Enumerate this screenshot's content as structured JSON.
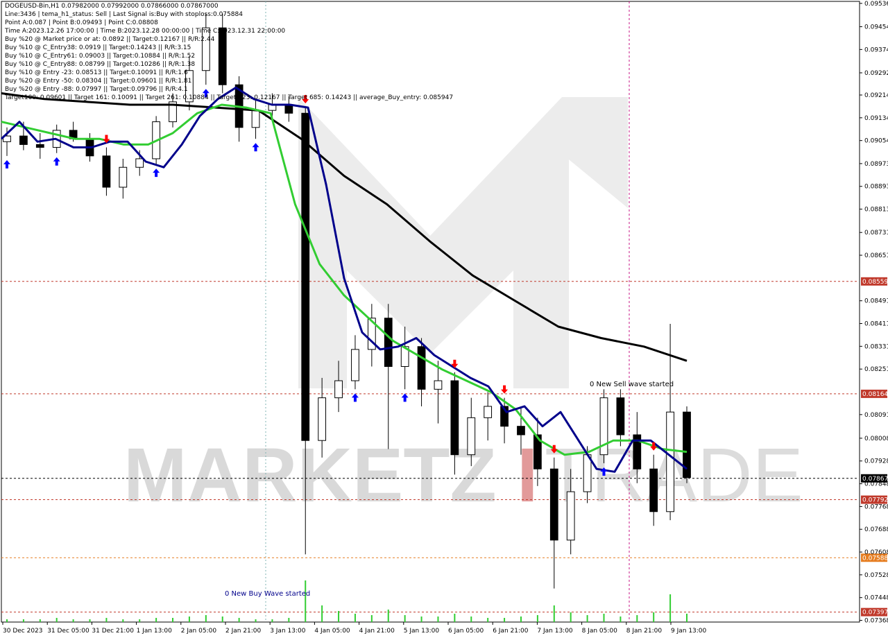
{
  "header": {
    "lines": [
      "DOGEUSD-Bin,H1  0.07982000 0.07992000 0.07866000 0.07867000",
      "Line:3436 | tema_h1_status: Sell | Last Signal is:Buy with stoploss:0.075884",
      "Point A:0.087 | Point B:0.09493 | Point C:0.08808",
      "Time A:2023.12.26 17:00:00 | Time B:2023.12.28 00:00:00 | Time C:2023.12.31 22:00:00",
      "Buy %20 @ Market price or at: 0.0892 || Target:0.12167 || R/R:2.44",
      "Buy %10 @ C_Entry38: 0.0919 || Target:0.14243 || R/R:3.15",
      "Buy %10 @ C_Entry61: 0.09003 || Target:0.10884 || R/R:1.52",
      "Buy %10 @ C_Entry88: 0.08799 || Target:0.10286 || R/R:1.38",
      "Buy %10 @ Entry -23: 0.08513 || Target:0.10091 || R/R:1.6",
      "Buy %20 @ Entry -50: 0.08304 || Target:0.09601 || R/R:1.81",
      "Buy %20 @ Entry -88: 0.07997 || Target:0.09796 || R/R:4.1",
      "Target100: 0.09601 || Target 161: 0.10091 || Target 261: 0.10884 || Target 423: 0.12167 || Target 685: 0.14243 || average_Buy_entry: 0.085947"
    ]
  },
  "watermark": {
    "left": "MARKETZ",
    "mid": "I",
    "right": "TRADE"
  },
  "annotations": {
    "sell_wave": "0 New Sell wave started",
    "buy_wave": "0 New Buy Wave started"
  },
  "colors": {
    "bull": "#000000",
    "bear": "#000000",
    "ema_fast": "#00008b",
    "ema_mid": "#32cd32",
    "ema_slow": "#000000",
    "buy_arrow": "#0000ff",
    "sell_arrow": "#ff0000",
    "level_line": "#b22222",
    "sell_tag": "#c0392b",
    "price_tag": "#000000",
    "volume": "#32cd32"
  },
  "chart_data": {
    "type": "candlestick",
    "symbol": "DOGEUSD-Bin",
    "timeframe": "H1",
    "y_ticks": [
      "0.09536",
      "0.09454",
      "0.09374",
      "0.09292",
      "0.09214",
      "0.09134",
      "0.09054",
      "0.08973",
      "0.08893",
      "0.08813",
      "0.08731",
      "0.08651",
      "0.08491",
      "0.08411",
      "0.08331",
      "0.08251",
      "0.08091",
      "0.08008",
      "0.07928",
      "0.07848",
      "0.07768",
      "0.07688",
      "0.07608",
      "0.07528",
      "0.07448",
      "0.07368"
    ],
    "ylim": [
      0.07362,
      0.09543
    ],
    "x_ticks": [
      "30 Dec 2023",
      "31 Dec 05:00",
      "31 Dec 21:00",
      "1 Jan 13:00",
      "2 Jan 05:00",
      "2 Jan 21:00",
      "3 Jan 13:00",
      "4 Jan 05:00",
      "4 Jan 21:00",
      "5 Jan 13:00",
      "6 Jan 05:00",
      "6 Jan 21:00",
      "7 Jan 13:00",
      "8 Jan 05:00",
      "8 Jan 21:00",
      "9 Jan 13:00"
    ],
    "levels": [
      {
        "value": 0.08559,
        "label": "0.08559",
        "color": "#c0392b"
      },
      {
        "value": 0.08164,
        "label": "0.08164",
        "color": "#c0392b"
      },
      {
        "value": 0.07867,
        "label": "0.07867",
        "color": "#000000"
      },
      {
        "value": 0.07792,
        "label": "0.07792",
        "color": "#c0392b"
      },
      {
        "value": 0.07588,
        "label": "0.07588",
        "color": "#e67e22"
      },
      {
        "value": 0.07397,
        "label": "0.07397",
        "color": "#c0392b"
      }
    ],
    "ema_fast": [
      0.0906,
      0.0912,
      0.0905,
      0.0906,
      0.0903,
      0.0903,
      0.0905,
      0.0905,
      0.0898,
      0.0896,
      0.0904,
      0.0914,
      0.092,
      0.0924,
      0.092,
      0.0918,
      0.0918,
      0.0917,
      0.089,
      0.0857,
      0.0838,
      0.0832,
      0.0833,
      0.0836,
      0.083,
      0.0826,
      0.0822,
      0.0819,
      0.081,
      0.0812,
      0.0805,
      0.081,
      0.08,
      0.079,
      0.0789,
      0.08,
      0.08,
      0.0795,
      0.079
    ],
    "ema_mid": [
      0.0912,
      0.091,
      0.0908,
      0.0906,
      0.0906,
      0.0904,
      0.0904,
      0.0908,
      0.0915,
      0.0918,
      0.0917,
      0.0915,
      0.0883,
      0.0862,
      0.0851,
      0.0843,
      0.0835,
      0.083,
      0.0825,
      0.0821,
      0.0817,
      0.0811,
      0.08,
      0.0795,
      0.0796,
      0.08,
      0.08,
      0.0797,
      0.0796
    ],
    "ema_slow": [
      0.0922,
      0.092,
      0.0919,
      0.0918,
      0.0918,
      0.0917,
      0.0916,
      0.0906,
      0.0893,
      0.0883,
      0.087,
      0.0858,
      0.0849,
      0.084,
      0.0836,
      0.0833,
      0.0828
    ],
    "candles": [
      {
        "o": 0.0905,
        "h": 0.091,
        "l": 0.09,
        "c": 0.0907
      },
      {
        "o": 0.0907,
        "h": 0.0912,
        "l": 0.0902,
        "c": 0.0904
      },
      {
        "o": 0.0904,
        "h": 0.0908,
        "l": 0.0899,
        "c": 0.0903
      },
      {
        "o": 0.0903,
        "h": 0.0911,
        "l": 0.0901,
        "c": 0.0909
      },
      {
        "o": 0.0909,
        "h": 0.0912,
        "l": 0.0905,
        "c": 0.0906
      },
      {
        "o": 0.0906,
        "h": 0.0908,
        "l": 0.0898,
        "c": 0.09
      },
      {
        "o": 0.09,
        "h": 0.0903,
        "l": 0.0886,
        "c": 0.0889
      },
      {
        "o": 0.0889,
        "h": 0.0899,
        "l": 0.0885,
        "c": 0.0896
      },
      {
        "o": 0.0896,
        "h": 0.0902,
        "l": 0.0893,
        "c": 0.0899
      },
      {
        "o": 0.0899,
        "h": 0.0914,
        "l": 0.0897,
        "c": 0.0912
      },
      {
        "o": 0.0912,
        "h": 0.0922,
        "l": 0.091,
        "c": 0.0919
      },
      {
        "o": 0.0919,
        "h": 0.0935,
        "l": 0.0916,
        "c": 0.093
      },
      {
        "o": 0.093,
        "h": 0.095,
        "l": 0.0925,
        "c": 0.0945
      },
      {
        "o": 0.0945,
        "h": 0.095,
        "l": 0.0922,
        "c": 0.0925
      },
      {
        "o": 0.0925,
        "h": 0.0928,
        "l": 0.0905,
        "c": 0.091
      },
      {
        "o": 0.091,
        "h": 0.092,
        "l": 0.0906,
        "c": 0.0916
      },
      {
        "o": 0.0916,
        "h": 0.0922,
        "l": 0.0912,
        "c": 0.0918
      },
      {
        "o": 0.0918,
        "h": 0.0921,
        "l": 0.0912,
        "c": 0.0915
      },
      {
        "o": 0.0915,
        "h": 0.0917,
        "l": 0.076,
        "c": 0.08
      },
      {
        "o": 0.08,
        "h": 0.0822,
        "l": 0.0794,
        "c": 0.0815
      },
      {
        "o": 0.0815,
        "h": 0.0828,
        "l": 0.081,
        "c": 0.0821
      },
      {
        "o": 0.0821,
        "h": 0.0837,
        "l": 0.0818,
        "c": 0.0832
      },
      {
        "o": 0.0832,
        "h": 0.0848,
        "l": 0.0826,
        "c": 0.0843
      },
      {
        "o": 0.0843,
        "h": 0.0848,
        "l": 0.0797,
        "c": 0.0826
      },
      {
        "o": 0.0826,
        "h": 0.084,
        "l": 0.0818,
        "c": 0.0833
      },
      {
        "o": 0.0833,
        "h": 0.0836,
        "l": 0.0812,
        "c": 0.0818
      },
      {
        "o": 0.0818,
        "h": 0.0828,
        "l": 0.0806,
        "c": 0.0821
      },
      {
        "o": 0.0821,
        "h": 0.0824,
        "l": 0.0788,
        "c": 0.0795
      },
      {
        "o": 0.0795,
        "h": 0.0815,
        "l": 0.0791,
        "c": 0.0808
      },
      {
        "o": 0.0808,
        "h": 0.0817,
        "l": 0.08,
        "c": 0.0812
      },
      {
        "o": 0.0812,
        "h": 0.0815,
        "l": 0.0799,
        "c": 0.0805
      },
      {
        "o": 0.0805,
        "h": 0.0812,
        "l": 0.0795,
        "c": 0.0802
      },
      {
        "o": 0.0802,
        "h": 0.0808,
        "l": 0.0784,
        "c": 0.079
      },
      {
        "o": 0.079,
        "h": 0.0794,
        "l": 0.0748,
        "c": 0.0765
      },
      {
        "o": 0.0765,
        "h": 0.079,
        "l": 0.076,
        "c": 0.0782
      },
      {
        "o": 0.0782,
        "h": 0.0798,
        "l": 0.0778,
        "c": 0.0795
      },
      {
        "o": 0.0795,
        "h": 0.0818,
        "l": 0.0792,
        "c": 0.0815
      },
      {
        "o": 0.0815,
        "h": 0.0818,
        "l": 0.0798,
        "c": 0.0802
      },
      {
        "o": 0.0802,
        "h": 0.081,
        "l": 0.0785,
        "c": 0.079
      },
      {
        "o": 0.079,
        "h": 0.0795,
        "l": 0.077,
        "c": 0.0775
      },
      {
        "o": 0.0775,
        "h": 0.0841,
        "l": 0.0772,
        "c": 0.081
      },
      {
        "o": 0.081,
        "h": 0.0812,
        "l": 0.0785,
        "c": 0.0787
      }
    ],
    "volume": [
      2,
      2,
      2,
      3,
      2,
      2,
      3,
      2,
      2,
      3,
      3,
      4,
      5,
      4,
      3,
      2,
      2,
      3,
      30,
      12,
      8,
      6,
      5,
      9,
      5,
      4,
      4,
      6,
      4,
      3,
      3,
      4,
      5,
      12,
      7,
      5,
      6,
      4,
      5,
      7,
      20,
      6
    ]
  }
}
